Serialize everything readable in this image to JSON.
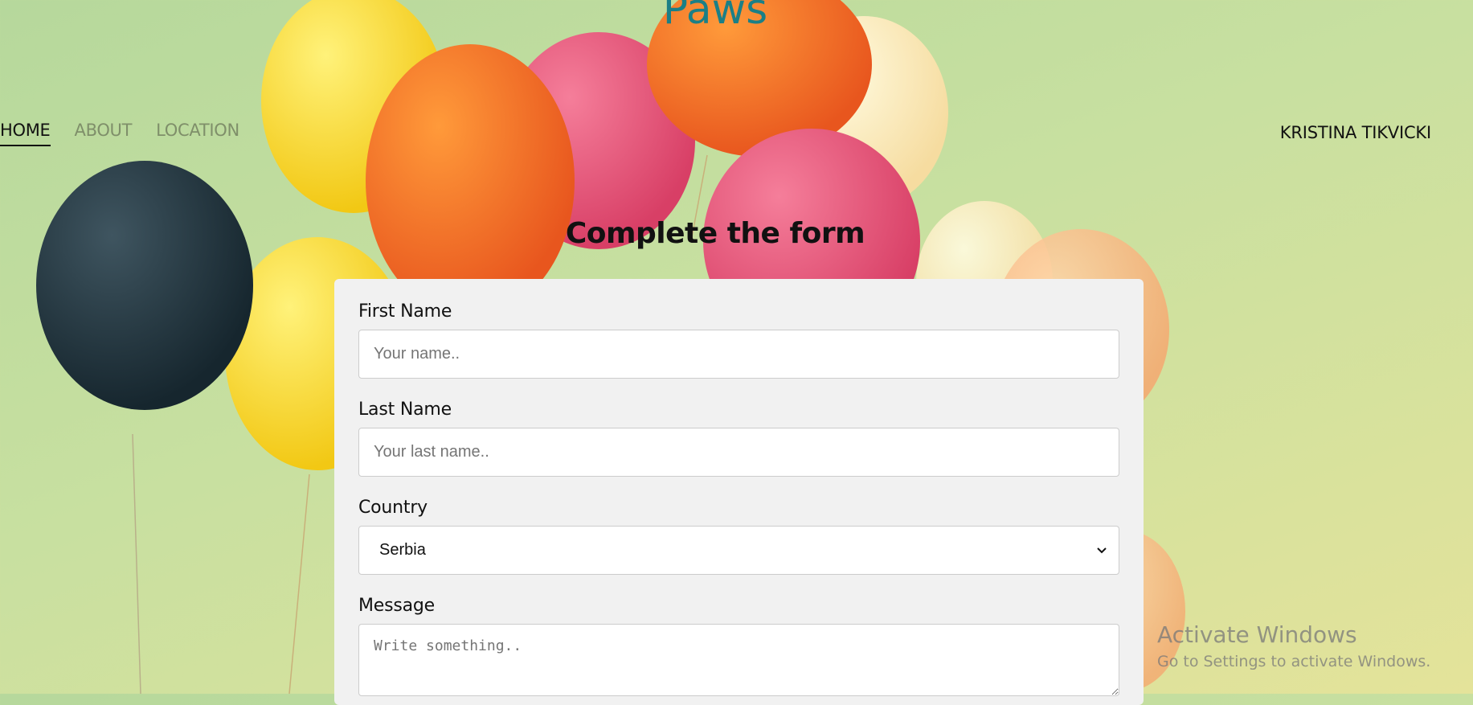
{
  "header": {
    "site_title": "Paws",
    "nav": [
      {
        "label": "HOME",
        "active": true
      },
      {
        "label": "ABOUT",
        "active": false
      },
      {
        "label": "LOCATION",
        "active": false
      }
    ],
    "user_name": "KRISTINA TIKVICKI"
  },
  "form": {
    "heading": "Complete the form",
    "first_name": {
      "label": "First Name",
      "placeholder": "Your name..",
      "value": ""
    },
    "last_name": {
      "label": "Last Name",
      "placeholder": "Your last name..",
      "value": ""
    },
    "country": {
      "label": "Country",
      "selected": "Serbia"
    },
    "message": {
      "label": "Message",
      "placeholder": "Write something..",
      "value": ""
    }
  },
  "watermark": {
    "title": "Activate Windows",
    "subtitle": "Go to Settings to activate Windows."
  },
  "colors": {
    "title": "#1b7f86",
    "card_bg": "#f1f1f1",
    "background": "#c8e0a0"
  }
}
